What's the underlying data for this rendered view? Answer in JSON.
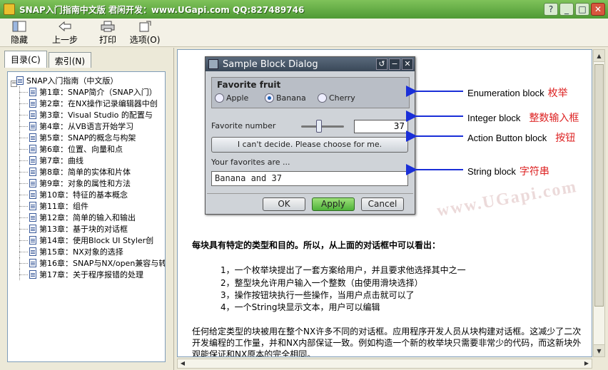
{
  "window": {
    "title": "SNAP入门指南中文版   君闲开发：www.UGapi.com   QQ:827489746",
    "controls": [
      "?",
      "_",
      "□",
      "✕"
    ]
  },
  "toolbar": [
    {
      "label": "隐藏",
      "icon": "hide-icon"
    },
    {
      "label": "上一步",
      "icon": "back-arrow-icon"
    },
    {
      "label": "打印",
      "icon": "printer-icon"
    },
    {
      "label": "选项(O)",
      "icon": "options-icon"
    }
  ],
  "tabs": [
    {
      "label": "目录(C)",
      "active": true
    },
    {
      "label": "索引(N)",
      "active": false
    }
  ],
  "tree": {
    "root": "SNAP入门指南（中文版）",
    "items": [
      "第1章：SNAP简介（SNAP入门）",
      "第2章：在NX操作记录编辑器中创",
      "第3章：Visual Studio 的配置与",
      "第4章：从VB语言开始学习",
      "第5章：SNAP的概念与构架",
      "第6章：位置、向量和点",
      "第7章：曲线",
      "第8章：简单的实体和片体",
      "第9章：对象的属性和方法",
      "第10章：特征的基本概念",
      "第11章：组件",
      "第12章：简单的输入和输出",
      "第13章：基于块的对话框",
      "第14章：使用Block UI Styler创",
      "第15章：NX对象的选择",
      "第16章：SNAP与NX/open兼容与转",
      "第17章：关于程序报错的处理"
    ]
  },
  "dialog": {
    "title": "Sample Block Dialog",
    "group_title": "Favorite fruit",
    "radios": [
      {
        "label": "Apple",
        "selected": false
      },
      {
        "label": "Banana",
        "selected": true
      },
      {
        "label": "Cherry",
        "selected": false
      }
    ],
    "number_label": "Favorite number",
    "number_value": "37",
    "action_button": "I can't decide. Please choose for me.",
    "string_label": "Your favorites are ...",
    "string_value": "Banana and 37",
    "buttons": {
      "ok": "OK",
      "apply": "Apply",
      "cancel": "Cancel"
    }
  },
  "annotations": [
    {
      "en": "Enumeration block",
      "cn": "枚举"
    },
    {
      "en": "Integer block",
      "cn": "整数输入框"
    },
    {
      "en": "Action Button block",
      "cn": "按钮"
    },
    {
      "en": "String block",
      "cn": "字符串"
    }
  ],
  "watermark": "www.UGapi.com",
  "content": {
    "heading": "每块具有特定的类型和目的。所以，从上面的对话框中可以看出：",
    "list": [
      "1，一个枚举块提出了一套方案给用户，并且要求他选择其中之一",
      "2，整型块允许用户输入一个整数（由使用滑块选择）",
      "3，操作按钮块执行一些操作，当用户点击就可以了",
      "4，一个String块显示文本，用户可以编辑"
    ],
    "paragraph": "任何给定类型的块被用在整个NX许多不同的对话框。应用程序开发人员从块构建对话框。这减少了二次开发编程的工作量，并和NX内部保证一致。例如构造一个新的枚举块只需要非常少的代码，而这新块外观能保证和NX原本的完全相同。"
  },
  "colors": {
    "arrow": "#1a2fd8",
    "annotation_cn": "#dd2222",
    "titlebar": "#5aa83f"
  }
}
